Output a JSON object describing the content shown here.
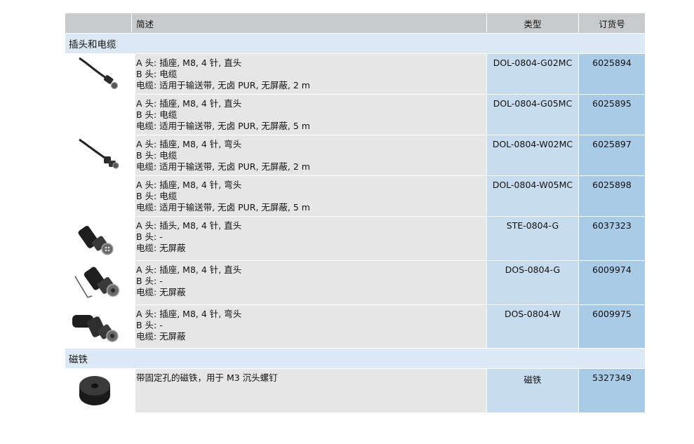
{
  "header": {
    "desc": "简述",
    "type": "类型",
    "order": "订货号"
  },
  "sections": [
    {
      "title": "插头和电缆",
      "rows": [
        {
          "image": "cable-straight-socket-image",
          "lines": [
            "A 头: 插座, M8, 4 针, 直头",
            "B 头: 电缆",
            "电缆: 适用于输送带, 无卤 PUR, 无屏蔽, 2 m"
          ],
          "type": "DOL-0804-G02MC",
          "order": "6025894"
        },
        {
          "image": "",
          "lines": [
            "A 头: 插座, M8, 4 针, 直头",
            "B 头: 电缆",
            "电缆: 适用于输送带, 无卤 PUR, 无屏蔽, 5 m"
          ],
          "type": "DOL-0804-G05MC",
          "order": "6025895"
        },
        {
          "image": "cable-angled-socket-image",
          "lines": [
            "A 头: 插座, M8, 4 针, 弯头",
            "B 头: 电缆",
            "电缆: 适用于输送带, 无卤 PUR, 无屏蔽, 2 m"
          ],
          "type": "DOL-0804-W02MC",
          "order": "6025897"
        },
        {
          "image": "",
          "lines": [
            "A 头: 插座, M8, 4 针, 弯头",
            "B 头: 电缆",
            "电缆: 适用于输送带, 无卤 PUR, 无屏蔽, 5 m"
          ],
          "type": "DOL-0804-W05MC",
          "order": "6025898"
        },
        {
          "image": "straight-plug-image",
          "lines": [
            "A 头: 插头, M8, 4 针, 直头",
            "B 头: -",
            "电缆: 无屏蔽"
          ],
          "type": "STE-0804-G",
          "order": "6037323"
        },
        {
          "image": "straight-socket-with-key-image",
          "lines": [
            "A 头: 插座, M8, 4 针, 直头",
            "B 头: -",
            "电缆: 无屏蔽"
          ],
          "type": "DOS-0804-G",
          "order": "6009974"
        },
        {
          "image": "angled-socket-image",
          "lines": [
            "A 头: 插座, M8, 4 针, 弯头",
            "B 头: -",
            "电缆: 无屏蔽"
          ],
          "type": "DOS-0804-W",
          "order": "6009975"
        }
      ]
    },
    {
      "title": "磁铁",
      "rows": [
        {
          "image": "magnet-image",
          "lines": [
            "带固定孔的磁铁，用于 M3 沉头螺钉"
          ],
          "type": "磁铁",
          "order": "5327349"
        }
      ]
    }
  ]
}
